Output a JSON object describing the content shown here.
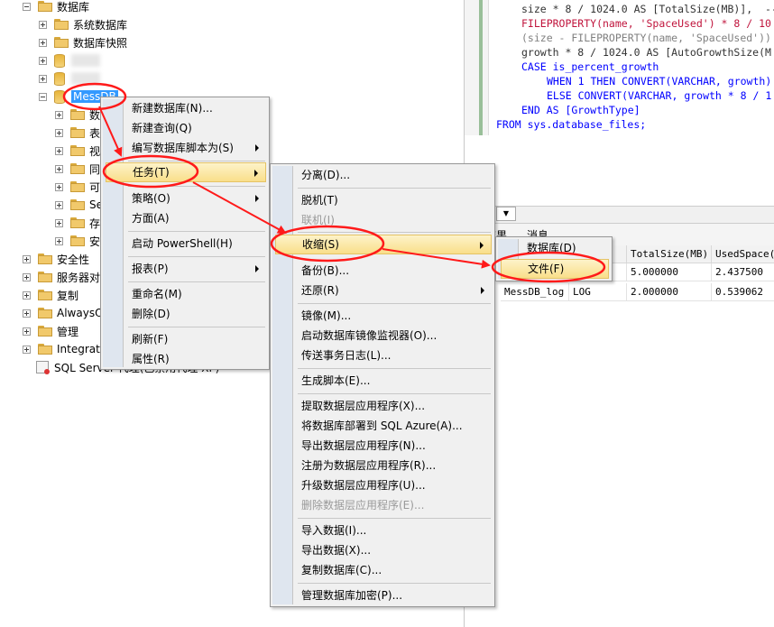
{
  "tree": {
    "root_label": "数据库",
    "items": [
      {
        "label": "系统数据库"
      },
      {
        "label": "数据库快照"
      },
      {
        "label": "MessDB"
      },
      {
        "label": "数"
      },
      {
        "label": "表"
      },
      {
        "label": "视"
      },
      {
        "label": "同"
      },
      {
        "label": "可"
      },
      {
        "label": "Se"
      },
      {
        "label": "存"
      },
      {
        "label": "安"
      },
      {
        "label": "安全性"
      },
      {
        "label": "服务器对象"
      },
      {
        "label": "复制"
      },
      {
        "label": "AlwaysOn"
      },
      {
        "label": "管理"
      },
      {
        "label": "Integration"
      },
      {
        "label": "SQL Server 代理(已禁用代理 XP)"
      }
    ]
  },
  "code": {
    "lines": [
      "size * 8 / 1024.0 AS [TotalSize(MB)],  --",
      "FILEPROPERTY(name, 'SpaceUsed') * 8 / 10",
      "(size - FILEPROPERTY(name, 'SpaceUsed'))",
      "growth * 8 / 1024.0 AS [AutoGrowthSize(M",
      "CASE is_percent_growth",
      "WHEN 1 THEN CONVERT(VARCHAR, growth)",
      "ELSE CONVERT(VARCHAR, growth * 8 / 1",
      "END AS [GrowthType]",
      "FROM sys.database_files;"
    ]
  },
  "results": {
    "tab_results": "结果",
    "tab_messages": "消息",
    "columns": [
      "",
      "",
      "TotalSize(MB)",
      "UsedSpace(M"
    ],
    "rows": [
      [
        "",
        "",
        "5.000000",
        "2.437500"
      ],
      [
        "MessDB_log",
        "LOG",
        "2.000000",
        "0.539062"
      ]
    ]
  },
  "menu1": {
    "items": [
      "新建数据库(N)...",
      "新建查询(Q)",
      "编写数据库脚本为(S)",
      "任务(T)",
      "策略(O)",
      "方面(A)",
      "启动 PowerShell(H)",
      "报表(P)",
      "重命名(M)",
      "删除(D)",
      "刷新(F)",
      "属性(R)"
    ]
  },
  "menu2": {
    "items": [
      "分离(D)...",
      "脱机(T)",
      "联机(I)",
      "收缩(S)",
      "备份(B)...",
      "还原(R)",
      "镜像(M)...",
      "启动数据库镜像监视器(O)...",
      "传送事务日志(L)...",
      "生成脚本(E)...",
      "提取数据层应用程序(X)...",
      "将数据库部署到 SQL Azure(A)...",
      "导出数据层应用程序(N)...",
      "注册为数据层应用程序(R)...",
      "升级数据层应用程序(U)...",
      "删除数据层应用程序(E)...",
      "导入数据(I)...",
      "导出数据(X)...",
      "复制数据库(C)...",
      "管理数据库加密(P)..."
    ]
  },
  "menu3": {
    "items": [
      "数据库(D)",
      "文件(F)"
    ]
  },
  "colors": {
    "annotation_red": "#ff1a1a",
    "selection_blue": "#3399ff",
    "menu_highlight": "#f9df8a"
  }
}
